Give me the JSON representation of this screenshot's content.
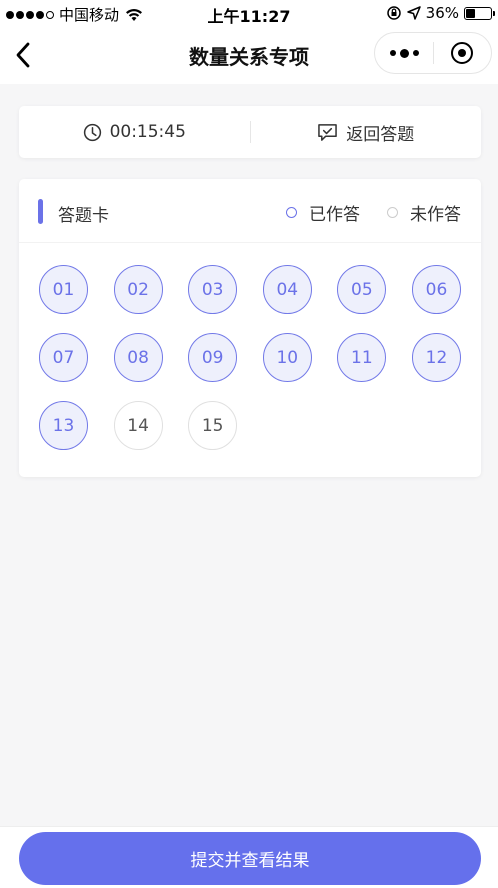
{
  "status_bar": {
    "carrier": "中国移动",
    "time": "上午11:27",
    "battery": "36%",
    "battery_level": 0.36
  },
  "nav": {
    "title": "数量关系专项"
  },
  "toolbar": {
    "timer": "00:15:45",
    "return_label": "返回答题"
  },
  "answer_sheet": {
    "title": "答题卡",
    "legend_done": "已作答",
    "legend_todo": "未作答",
    "questions": [
      {
        "num": "01",
        "answered": true
      },
      {
        "num": "02",
        "answered": true
      },
      {
        "num": "03",
        "answered": true
      },
      {
        "num": "04",
        "answered": true
      },
      {
        "num": "05",
        "answered": true
      },
      {
        "num": "06",
        "answered": true
      },
      {
        "num": "07",
        "answered": true
      },
      {
        "num": "08",
        "answered": true
      },
      {
        "num": "09",
        "answered": true
      },
      {
        "num": "10",
        "answered": true
      },
      {
        "num": "11",
        "answered": true
      },
      {
        "num": "12",
        "answered": true
      },
      {
        "num": "13",
        "answered": true
      },
      {
        "num": "14",
        "answered": false
      },
      {
        "num": "15",
        "answered": false
      }
    ]
  },
  "submit": {
    "label": "提交并查看结果"
  },
  "colors": {
    "accent": "#6570ec",
    "answered_bg": "#eef0fc"
  }
}
